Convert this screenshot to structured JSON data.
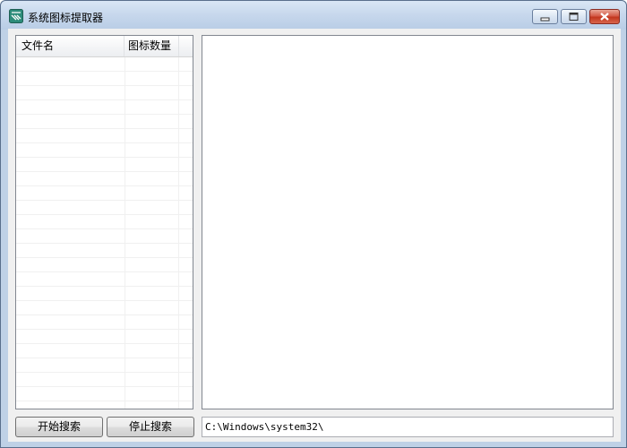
{
  "window": {
    "title": "系统图标提取器",
    "controls": {
      "minimize_icon": "minimize-icon",
      "maximize_icon": "maximize-icon",
      "close_icon": "close-icon"
    }
  },
  "list": {
    "columns": [
      "文件名",
      "图标数量",
      ""
    ],
    "rows": []
  },
  "buttons": {
    "start_label": "开始搜索",
    "stop_label": "停止搜索"
  },
  "path": {
    "value": "C:\\Windows\\system32\\"
  },
  "colors": {
    "titlebar": "#c6d7ec",
    "close_button": "#c2361e",
    "client_bg": "#f0f0f0"
  }
}
